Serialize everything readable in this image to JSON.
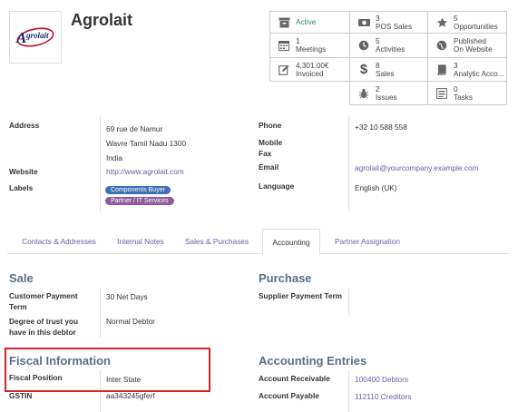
{
  "partner": {
    "name": "Agrolait",
    "logo_text": "grolait"
  },
  "smart_buttons": [
    {
      "id": "active",
      "icon": "archive-icon",
      "lines": [
        "Active"
      ]
    },
    {
      "id": "pos",
      "icon": "money-icon",
      "lines": [
        "3",
        "POS Sales"
      ]
    },
    {
      "id": "opps",
      "icon": "star-icon",
      "lines": [
        "5",
        "Opportunities"
      ]
    },
    {
      "id": "meetings",
      "icon": "calendar-icon",
      "lines": [
        "1",
        "Meetings"
      ]
    },
    {
      "id": "activities",
      "icon": "clock-icon",
      "lines": [
        "5",
        "Activities"
      ]
    },
    {
      "id": "website",
      "icon": "globe-icon",
      "lines": [
        "Published",
        "On Website"
      ]
    },
    {
      "id": "invoiced",
      "icon": "pencil-square-icon",
      "lines": [
        "4,301.00€",
        "Invoiced"
      ]
    },
    {
      "id": "sales",
      "icon": "dollar-icon",
      "lines": [
        "8",
        "Sales"
      ]
    },
    {
      "id": "analytic",
      "icon": "book-icon",
      "lines": [
        "3",
        "Analytic Acco..."
      ]
    },
    {
      "id": "issues",
      "icon": "bug-icon",
      "lines": [
        "2",
        "Issues"
      ]
    },
    {
      "id": "tasks",
      "icon": "tasks-icon",
      "lines": [
        "0",
        "Tasks"
      ]
    }
  ],
  "info": {
    "address_label": "Address",
    "address_lines": [
      "69 rue de Namur",
      "Wavre Tamil Nadu 1300",
      "India"
    ],
    "website_label": "Website",
    "website": "http://www.agrolait.com",
    "labels_label": "Labels",
    "tags": [
      {
        "text": "Components Buyer",
        "color": "#3f6fb6"
      },
      {
        "text": "Partner / IT Services",
        "color": "#8e5a9d"
      }
    ],
    "phone_label": "Phone",
    "phone": "+32 10 588 558",
    "mobile_label": "Mobile",
    "fax_label": "Fax",
    "email_label": "Email",
    "email": "agrolait@yourcompany.example.com",
    "language_label": "Language",
    "language": "English (UK)"
  },
  "tabs": [
    "Contacts & Addresses",
    "Internal Notes",
    "Sales & Purchases",
    "Accounting",
    "Partner Assignation"
  ],
  "active_tab": "Accounting",
  "accounting": {
    "sale_title": "Sale",
    "customer_payment_term_label": "Customer Payment Term",
    "customer_payment_term": "30 Net Days",
    "trust_label": "Degree of trust you have in this debtor",
    "trust": "Normal Debtor",
    "purchase_title": "Purchase",
    "supplier_payment_term_label": "Supplier Payment Term",
    "fiscal_title": "Fiscal Information",
    "fiscal_position_label": "Fiscal Position",
    "fiscal_position": "Inter State",
    "gstin_label": "GSTIN",
    "gstin": "aa343245gferf",
    "entries_title": "Accounting Entries",
    "receivable_label": "Account Receivable",
    "receivable": "100400 Debtors",
    "payable_label": "Account Payable",
    "payable": "112110 Creditors"
  }
}
